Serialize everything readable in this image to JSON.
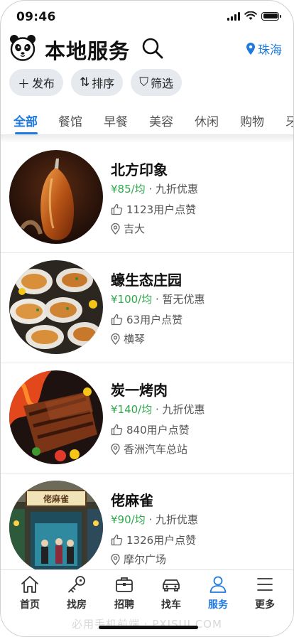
{
  "status_bar": {
    "time": "09:46"
  },
  "header": {
    "title": "本地服务",
    "location": "珠海"
  },
  "actions": [
    {
      "icon": "plus-icon",
      "glyph": "＋",
      "label": "发布"
    },
    {
      "icon": "sort-icon",
      "glyph": "⇅",
      "label": "排序"
    },
    {
      "icon": "filter-icon",
      "glyph": "⛉",
      "label": "筛选"
    }
  ],
  "tabs": [
    "全部",
    "餐馆",
    "早餐",
    "美容",
    "休闲",
    "购物",
    "牙"
  ],
  "active_tab": "全部",
  "listings": [
    {
      "name": "北方印象",
      "price": "¥85/均",
      "sep": " · ",
      "offer": "九折优惠",
      "likes": "1123用户点赞",
      "location": "吉大"
    },
    {
      "name": "蠔生态庄园",
      "price": "¥100/均",
      "sep": " · ",
      "offer": "暂无优惠",
      "likes": "63用户点赞",
      "location": "横琴"
    },
    {
      "name": "炭一烤肉",
      "price": "¥140/均",
      "sep": " · ",
      "offer": "九折优惠",
      "likes": "840用户点赞",
      "location": "香洲汽车总站"
    },
    {
      "name": "佬麻雀",
      "price": "¥90/均",
      "sep": " · ",
      "offer": "九折优惠",
      "likes": "1326用户点赞",
      "location": "摩尔广场",
      "sign": "佬麻雀"
    }
  ],
  "bottom_nav": [
    {
      "label": "首页",
      "icon": "home-icon"
    },
    {
      "label": "找房",
      "icon": "key-icon"
    },
    {
      "label": "招聘",
      "icon": "briefcase-icon"
    },
    {
      "label": "找车",
      "icon": "car-icon"
    },
    {
      "label": "服务",
      "icon": "person-icon",
      "active": true
    },
    {
      "label": "更多",
      "icon": "menu-icon"
    }
  ],
  "watermark": "必用手机前端 · PXISUI.COM",
  "colors": {
    "accent": "#1f7ae0",
    "price": "#2ea84a",
    "pill_bg": "#e6e9ee"
  }
}
